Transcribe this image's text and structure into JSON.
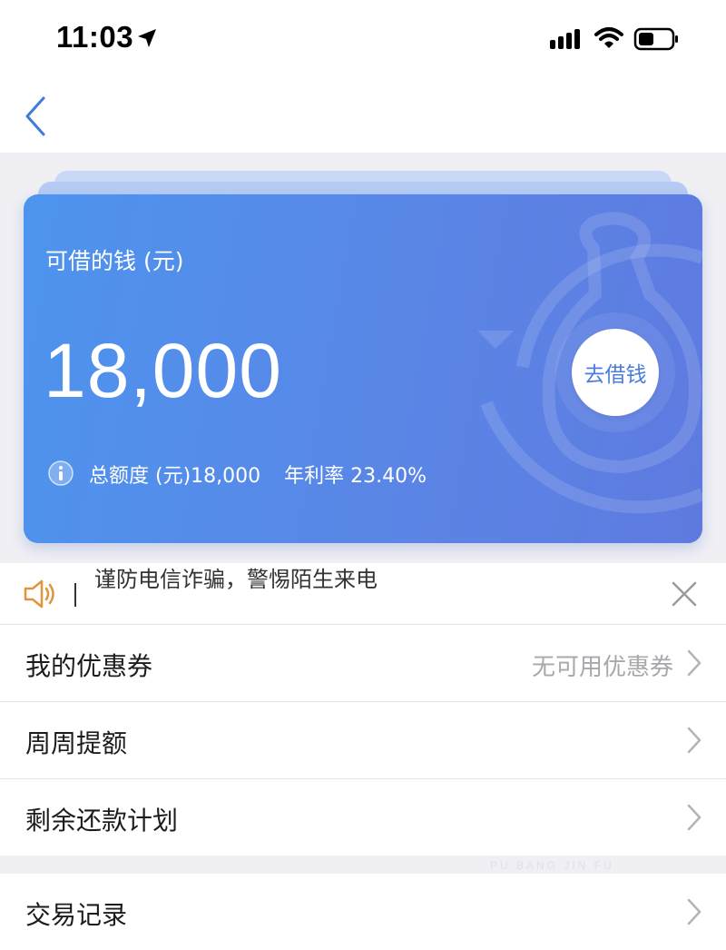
{
  "status_bar": {
    "time": "11:03"
  },
  "card": {
    "title": "可借的钱 (元)",
    "amount": "18,000",
    "borrow_button": "去借钱",
    "total_credit": "总额度 (元)18,000",
    "annual_rate": "年利率 23.40%"
  },
  "notice": {
    "text": "谨防电信诈骗，警惕陌生来电"
  },
  "list": [
    {
      "label": "我的优惠券",
      "value": "无可用优惠券"
    },
    {
      "label": "周周提额"
    },
    {
      "label": "剩余还款计划"
    }
  ],
  "list2": [
    {
      "label": "交易记录"
    }
  ],
  "watermark": "PU BANG JIN FU",
  "colors": {
    "card_gradient_start": "#4d94ee",
    "card_gradient_end": "#5e7ae0",
    "accent": "#4a7de0",
    "speaker_icon": "#e0953a",
    "background_gray": "#efeff4"
  },
  "icons": {
    "back": "chevron-left-icon",
    "info": "info-icon",
    "speaker": "speaker-icon",
    "close": "close-icon",
    "row": "chevron-right-icon",
    "location": "location-arrow-icon",
    "signal": "signal-icon",
    "wifi": "wifi-icon",
    "battery": "battery-icon"
  }
}
